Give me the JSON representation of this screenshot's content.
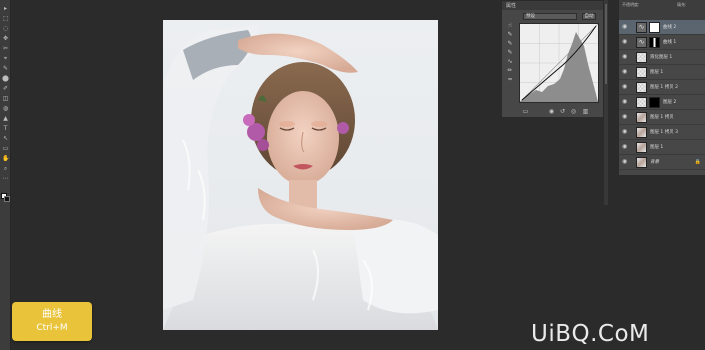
{
  "tooltip": {
    "title": "曲线",
    "shortcut": "Ctrl+M"
  },
  "properties": {
    "tab_label": "属性",
    "preset": "预设",
    "auto_button": "自动",
    "tools": [
      "sample-in-image-icon",
      "eyedropper-black-icon",
      "eyedropper-gray-icon",
      "eyedropper-white-icon",
      "curve-point-icon",
      "pencil-icon",
      "smooth-icon"
    ],
    "footer_icons": [
      "clip-to-layer-icon",
      "view-previous-icon",
      "reset-icon",
      "visibility-icon",
      "trash-icon"
    ]
  },
  "layers_panel": {
    "options": [
      "不透明度:",
      "填充:"
    ],
    "layers": [
      {
        "name": "曲线 2",
        "thumb": "adj",
        "mask": "white",
        "selected": true,
        "linked": true
      },
      {
        "name": "曲线 1",
        "thumb": "adj",
        "mask": "bw",
        "selected": false,
        "linked": true
      },
      {
        "name": "液化图层 1",
        "thumb": "checker",
        "mask": "",
        "selected": false
      },
      {
        "name": "图层 1",
        "thumb": "checker",
        "mask": "",
        "selected": false
      },
      {
        "name": "图层 1 拷贝 2",
        "thumb": "checker",
        "mask": "",
        "selected": false
      },
      {
        "name": "图层 2",
        "thumb": "checker",
        "mask": "black",
        "selected": false
      },
      {
        "name": "图层 1 拷贝",
        "thumb": "photo",
        "mask": "",
        "selected": false
      },
      {
        "name": "图层 1 拷贝 3",
        "thumb": "photo",
        "mask": "",
        "selected": false
      },
      {
        "name": "图层 1",
        "thumb": "photo",
        "mask": "",
        "selected": false
      },
      {
        "name": "背景",
        "thumb": "photo",
        "mask": "",
        "selected": false,
        "italic": true,
        "locked": true
      }
    ]
  },
  "watermark": "UiBQ.CoM",
  "colors": {
    "tooltip_bg": "#e9c43a",
    "panel_bg": "#474747",
    "app_bg": "#2b2b2b",
    "selected_row": "#5b6570"
  }
}
